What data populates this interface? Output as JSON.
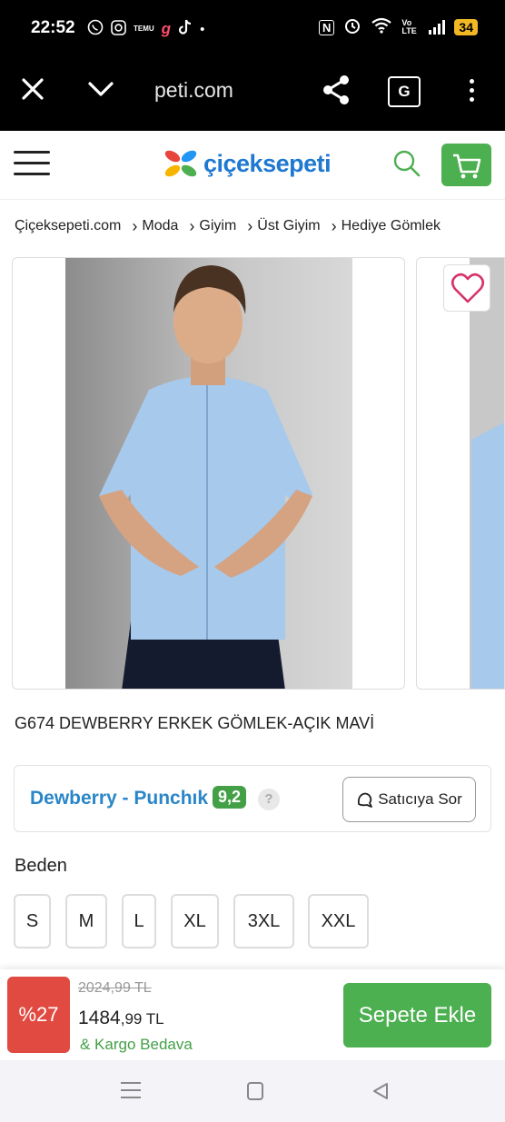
{
  "status_bar": {
    "time": "22:52",
    "apps": [
      "whatsapp-icon",
      "instagram-icon",
      "temu-icon",
      "app-icon",
      "tiktok-icon"
    ],
    "temu_text": "TEMU",
    "dot": "•",
    "nfc": "N",
    "volte": "Vo LTE",
    "battery": "34"
  },
  "browser": {
    "url": "peti.com",
    "translate_label": "G"
  },
  "site": {
    "logo_text": "çiçeksepeti",
    "brand_color": "#1f78d1",
    "accent_color": "#4caf50"
  },
  "breadcrumb": [
    "Çiçeksepeti.com",
    "Moda",
    "Giyim",
    "Üst Giyim",
    "Hediye Gömlek"
  ],
  "product": {
    "title": "G674 DEWBERRY ERKEK GÖMLEK-AÇIK MAVİ"
  },
  "seller": {
    "name": "Dewberry - Punchık",
    "score": "9,2",
    "help": "?",
    "ask_label": "Satıcıya Sor"
  },
  "sizes": {
    "label": "Beden",
    "options": [
      "S",
      "M",
      "L",
      "XL",
      "3XL",
      "XXL"
    ]
  },
  "purchase": {
    "discount": "%27",
    "old_price": "2024,99 TL",
    "price_int": "1484",
    "price_dec": ",99 TL",
    "shipping": "& Kargo Bedava",
    "add_to_cart": "Sepete Ekle",
    "discount_color": "#e04a41"
  }
}
